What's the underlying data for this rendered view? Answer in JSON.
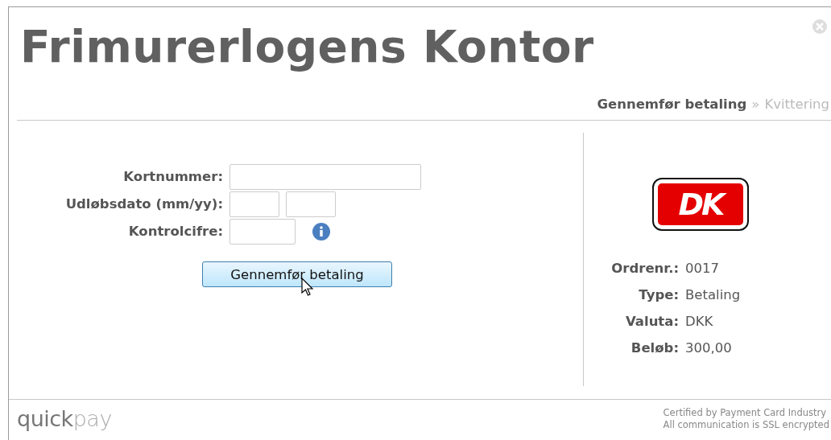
{
  "title": "Frimurerlogens Kontor",
  "steps": [
    {
      "label": "Gennemfør betaling",
      "selected": true
    },
    {
      "label": "Kvittering",
      "selected": false
    }
  ],
  "step_separator": "»",
  "form": {
    "fields": [
      {
        "label": "Kortnummer:",
        "kind": "card",
        "info": false
      },
      {
        "label": "Udløbsdato (mm/yy):",
        "kind": "date",
        "info": false
      },
      {
        "label": "Kontrolcifre:",
        "kind": "cvc",
        "info": true
      }
    ],
    "submit": "Gennemfør betaling"
  },
  "card_logo": "DK",
  "order": [
    {
      "label": "Ordrenr.:",
      "value": "0017"
    },
    {
      "label": "Type:",
      "value": "Betaling"
    },
    {
      "label": "Valuta:",
      "value": "DKK"
    },
    {
      "label": "Beløb:",
      "value": "300,00"
    }
  ],
  "footer": {
    "logo": {
      "strong": "quick",
      "light": "pay"
    },
    "lines": [
      "Certified by Payment Card Industry",
      "All communication is SSL encrypted"
    ]
  }
}
